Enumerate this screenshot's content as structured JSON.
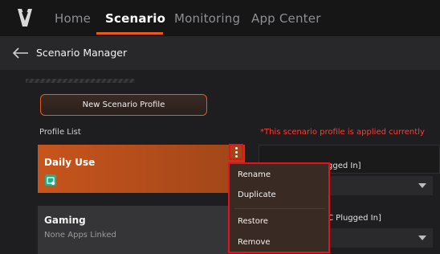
{
  "nav": {
    "items": [
      {
        "label": "Home",
        "active": false
      },
      {
        "label": "Scenario",
        "active": true
      },
      {
        "label": "Monitoring",
        "active": false
      },
      {
        "label": "App Center",
        "active": false
      }
    ],
    "accent": "#e8591a"
  },
  "header": {
    "title": "Scenario Manager"
  },
  "toolbar": {
    "new_profile_label": "New Scenario Profile"
  },
  "profile_list": {
    "label": "Profile List",
    "applied_note": "*This scenario profile is applied currently",
    "profiles": [
      {
        "name": "Daily Use",
        "subtitle": "",
        "active": true
      },
      {
        "name": "Gaming",
        "subtitle": "None Apps Linked",
        "active": false
      }
    ]
  },
  "settings": {
    "row1_label": "gged In]",
    "row2_label": "C Plugged In]"
  },
  "context_menu": {
    "items": [
      "Rename",
      "Duplicate",
      "Restore",
      "Remove"
    ]
  },
  "colors": {
    "active_card": "#c7541c",
    "highlight_border": "#e8101a",
    "applied_note": "#ff3b30"
  }
}
